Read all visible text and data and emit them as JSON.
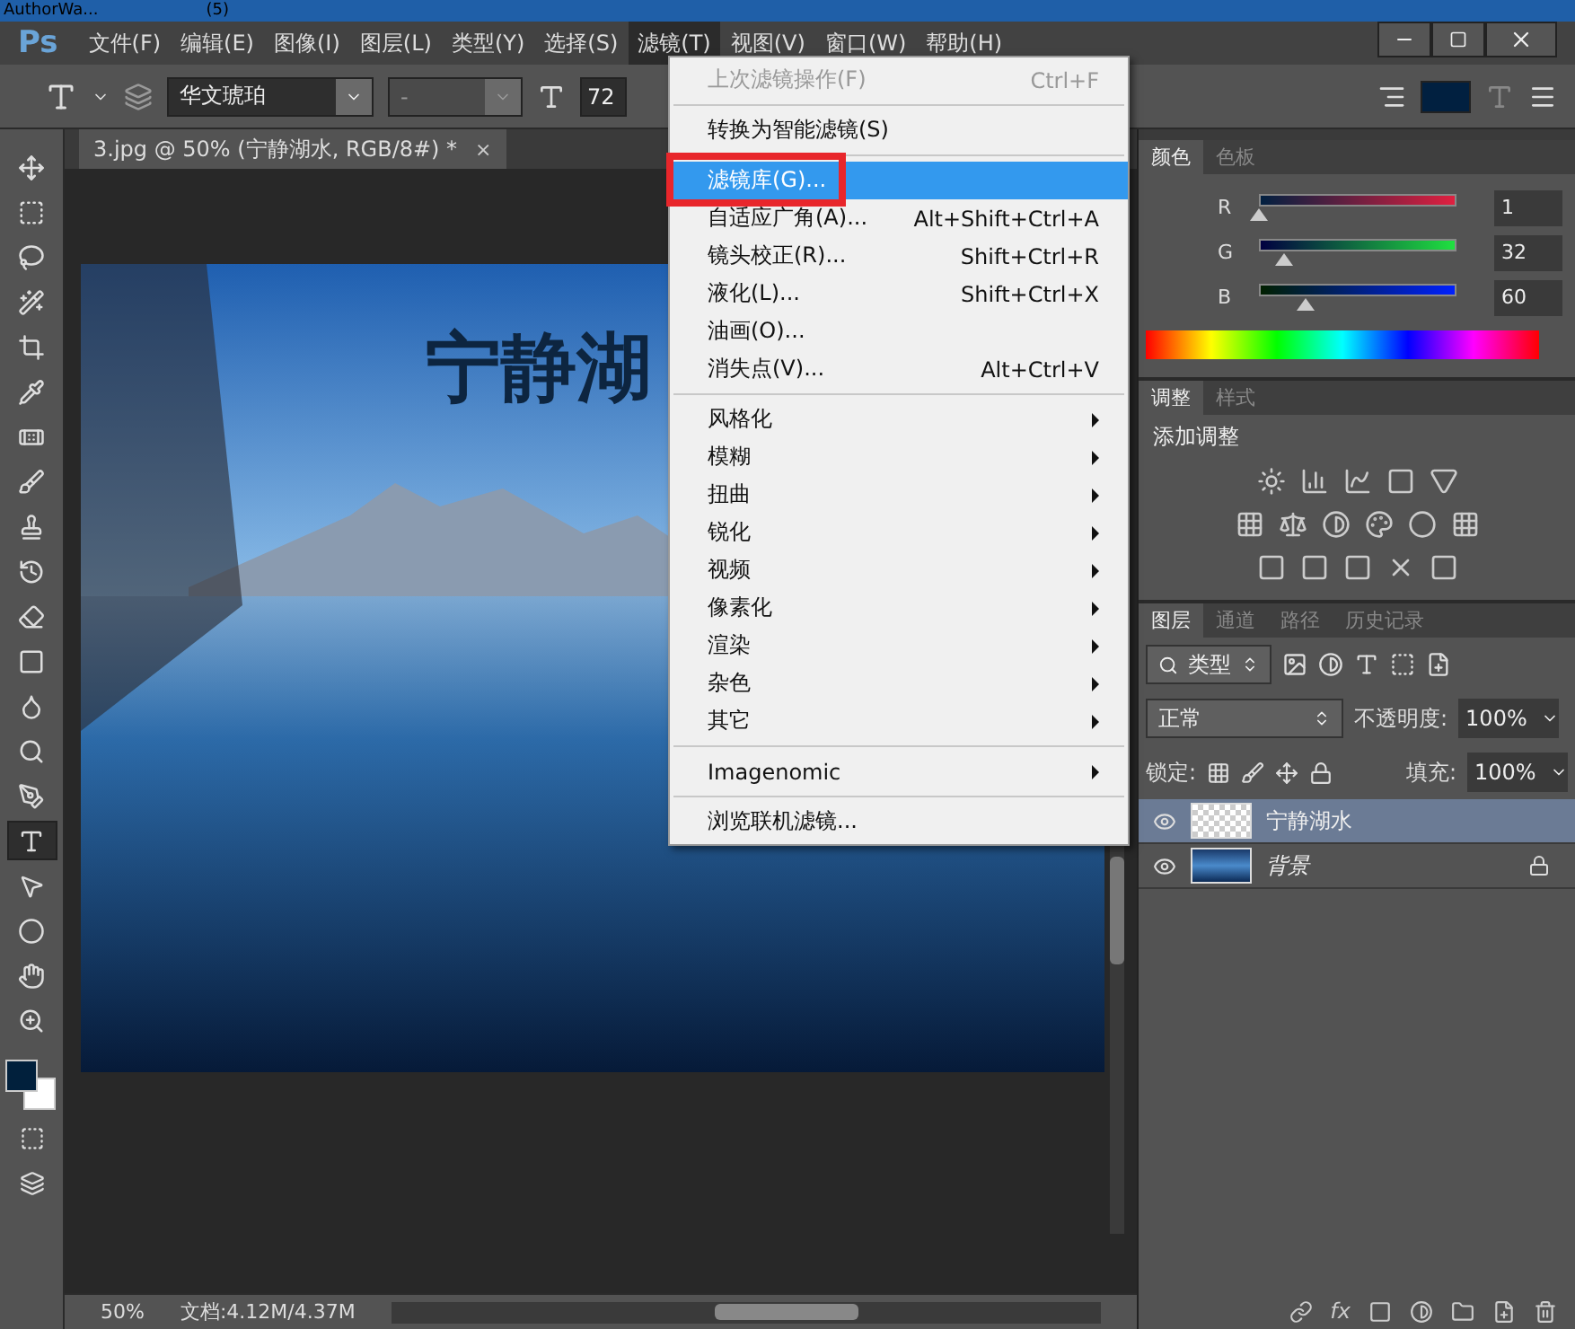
{
  "taskbar": {
    "items": [
      "AuthorWa...",
      "(5)"
    ]
  },
  "menubar": {
    "logo": "Ps",
    "items": [
      {
        "label": "文件(F)",
        "selected": false
      },
      {
        "label": "编辑(E)",
        "selected": false
      },
      {
        "label": "图像(I)",
        "selected": false
      },
      {
        "label": "图层(L)",
        "selected": false
      },
      {
        "label": "类型(Y)",
        "selected": false
      },
      {
        "label": "选择(S)",
        "selected": false
      },
      {
        "label": "滤镜(T)",
        "selected": true
      },
      {
        "label": "视图(V)",
        "selected": false
      },
      {
        "label": "窗口(W)",
        "selected": false
      },
      {
        "label": "帮助(H)",
        "selected": false
      }
    ]
  },
  "options_bar": {
    "font_family": "华文琥珀",
    "font_style": "-",
    "font_size": "72"
  },
  "document": {
    "tab_title": "3.jpg @ 50% (宁静湖水, RGB/8#) *",
    "close": "×",
    "canvas_text": "宁静湖"
  },
  "tools": [
    {
      "kind": "move",
      "selected": false
    },
    {
      "kind": "marquee",
      "selected": false
    },
    {
      "kind": "lasso",
      "selected": false
    },
    {
      "kind": "quick-select",
      "selected": false
    },
    {
      "kind": "crop",
      "selected": false
    },
    {
      "kind": "eyedropper",
      "selected": false
    },
    {
      "kind": "healing",
      "selected": false
    },
    {
      "kind": "brush",
      "selected": false
    },
    {
      "kind": "stamp",
      "selected": false
    },
    {
      "kind": "history-brush",
      "selected": false
    },
    {
      "kind": "eraser",
      "selected": false
    },
    {
      "kind": "gradient",
      "selected": false
    },
    {
      "kind": "blur",
      "selected": false
    },
    {
      "kind": "dodge",
      "selected": false
    },
    {
      "kind": "pen",
      "selected": false
    },
    {
      "kind": "type",
      "selected": true
    },
    {
      "kind": "path-select",
      "selected": false
    },
    {
      "kind": "ellipse",
      "selected": false
    },
    {
      "kind": "hand",
      "selected": false
    },
    {
      "kind": "zoom",
      "selected": false
    }
  ],
  "filter_menu": {
    "groups": [
      [
        {
          "label": "上次滤镜操作(F)",
          "shortcut": "Ctrl+F",
          "disabled": true,
          "selected": false,
          "submenu": false,
          "annotated": false
        }
      ],
      [
        {
          "label": "转换为智能滤镜(S)",
          "disabled": false,
          "selected": false,
          "submenu": false,
          "annotated": false
        }
      ],
      [
        {
          "label": "滤镜库(G)...",
          "disabled": false,
          "selected": true,
          "submenu": false,
          "annotated": true
        },
        {
          "label": "自适应广角(A)...",
          "shortcut": "Alt+Shift+Ctrl+A",
          "disabled": false,
          "selected": false,
          "submenu": false,
          "annotated": false
        },
        {
          "label": "镜头校正(R)...",
          "shortcut": "Shift+Ctrl+R",
          "disabled": false,
          "selected": false,
          "submenu": false,
          "annotated": false
        },
        {
          "label": "液化(L)...",
          "shortcut": "Shift+Ctrl+X",
          "disabled": false,
          "selected": false,
          "submenu": false,
          "annotated": false
        },
        {
          "label": "油画(O)...",
          "disabled": false,
          "selected": false,
          "submenu": false,
          "annotated": false
        },
        {
          "label": "消失点(V)...",
          "shortcut": "Alt+Ctrl+V",
          "disabled": false,
          "selected": false,
          "submenu": false,
          "annotated": false
        }
      ],
      [
        {
          "label": "风格化",
          "disabled": false,
          "selected": false,
          "submenu": true,
          "annotated": false
        },
        {
          "label": "模糊",
          "disabled": false,
          "selected": false,
          "submenu": true,
          "annotated": false
        },
        {
          "label": "扭曲",
          "disabled": false,
          "selected": false,
          "submenu": true,
          "annotated": false
        },
        {
          "label": "锐化",
          "disabled": false,
          "selected": false,
          "submenu": true,
          "annotated": false
        },
        {
          "label": "视频",
          "disabled": false,
          "selected": false,
          "submenu": true,
          "annotated": false
        },
        {
          "label": "像素化",
          "disabled": false,
          "selected": false,
          "submenu": true,
          "annotated": false
        },
        {
          "label": "渲染",
          "disabled": false,
          "selected": false,
          "submenu": true,
          "annotated": false
        },
        {
          "label": "杂色",
          "disabled": false,
          "selected": false,
          "submenu": true,
          "annotated": false
        },
        {
          "label": "其它",
          "disabled": false,
          "selected": false,
          "submenu": true,
          "annotated": false
        }
      ],
      [
        {
          "label": "Imagenomic",
          "disabled": false,
          "selected": false,
          "submenu": true,
          "annotated": false
        }
      ],
      [
        {
          "label": "浏览联机滤镜...",
          "disabled": false,
          "selected": false,
          "submenu": false,
          "annotated": false
        }
      ]
    ]
  },
  "color_panel": {
    "tabs": [
      {
        "label": "颜色",
        "selected": true
      },
      {
        "label": "色板",
        "selected": false
      }
    ],
    "channels": [
      {
        "name": "R",
        "value": "1",
        "level": 0.004
      },
      {
        "name": "G",
        "value": "32",
        "level": 0.125
      },
      {
        "name": "B",
        "value": "60",
        "level": 0.235
      }
    ]
  },
  "adjustments_panel": {
    "tabs": [
      {
        "label": "调整",
        "selected": true
      },
      {
        "label": "样式",
        "selected": false
      }
    ],
    "title": "添加调整"
  },
  "layers_panel": {
    "tabs": [
      {
        "label": "图层",
        "selected": true
      },
      {
        "label": "通道",
        "selected": false
      },
      {
        "label": "路径",
        "selected": false
      },
      {
        "label": "历史记录",
        "selected": false
      }
    ],
    "filter": "类型",
    "blend_mode": "正常",
    "opacity_label": "不透明度:",
    "opacity": "100%",
    "lock_label": "锁定:",
    "fill_label": "填充:",
    "fill": "100%",
    "layers": [
      {
        "name": "宁静湖水",
        "kind": "text",
        "selected": true,
        "visible": true,
        "locked": false
      },
      {
        "name": "背景",
        "kind": "background",
        "selected": false,
        "visible": true,
        "locked": true
      }
    ],
    "footer_fx": "fx"
  },
  "status_bar": {
    "zoom": "50%",
    "document_size": "文档:4.12M/4.37M"
  }
}
